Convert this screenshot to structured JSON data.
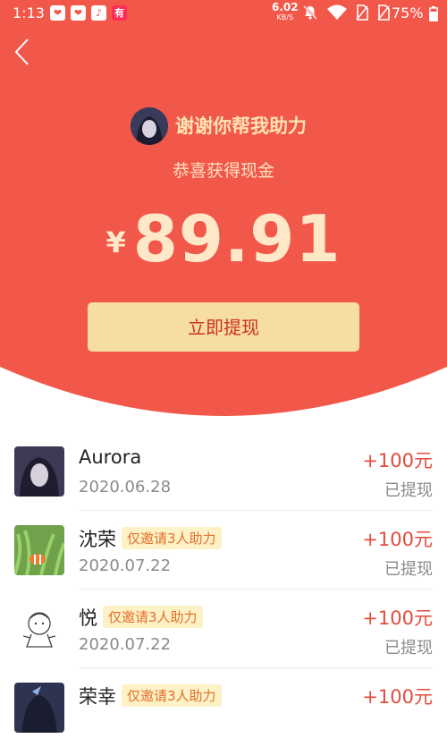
{
  "status_bar": {
    "time": "1:13",
    "app_icons": [
      "❤",
      "❤",
      "♪",
      "有"
    ],
    "net_speed": "6.02",
    "net_unit": "KB/S",
    "battery": "75%"
  },
  "hero": {
    "title": "谢谢你帮我助力",
    "subtitle": "恭喜获得现金",
    "currency": "¥",
    "amount": "89.91",
    "withdraw_label": "立即提现"
  },
  "list": [
    {
      "name": "Aurora",
      "badge": "",
      "date": "2020.06.28",
      "reward": "+100元",
      "status": "已提现"
    },
    {
      "name": "沈荣",
      "badge": "仅邀请3人助力",
      "date": "2020.07.22",
      "reward": "+100元",
      "status": "已提现"
    },
    {
      "name": "悦",
      "badge": "仅邀请3人助力",
      "date": "2020.07.22",
      "reward": "+100元",
      "status": "已提现"
    },
    {
      "name": "荣幸",
      "badge": "仅邀请3人助力",
      "date": "",
      "reward": "+100元",
      "status": ""
    }
  ],
  "colors": {
    "hero_bg": "#f2584a",
    "button_bg": "#f6dea3",
    "reward": "#e24c3c"
  }
}
